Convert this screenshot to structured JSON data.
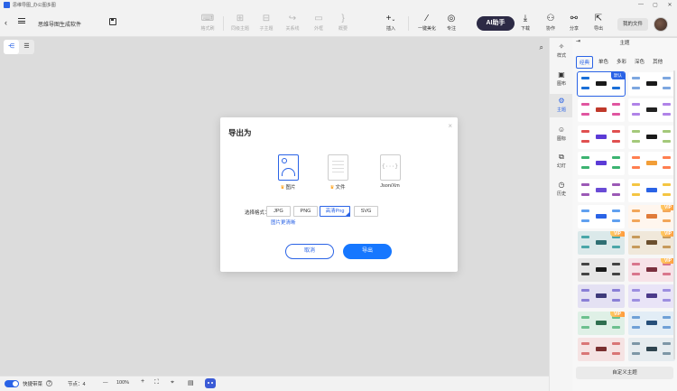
{
  "window": {
    "title": "思维导图_办公图多图",
    "controls": [
      "—",
      "▢",
      "✕"
    ]
  },
  "toolbar": {
    "doc_title": "思维导图生成软件",
    "tools": [
      {
        "id": "format-painter",
        "label": "格式刷",
        "icon": "paint-roller-icon"
      },
      {
        "id": "sibling-topic",
        "label": "同级主题",
        "icon": "sibling-topic-icon"
      },
      {
        "id": "child-topic",
        "label": "子主题",
        "icon": "child-topic-icon"
      },
      {
        "id": "relation",
        "label": "关系线",
        "icon": "relation-line-icon"
      },
      {
        "id": "outline",
        "label": "外框",
        "icon": "outline-box-icon"
      },
      {
        "id": "summary",
        "label": "概要",
        "icon": "summary-icon"
      },
      {
        "id": "insert",
        "label": "插入",
        "icon": "plus-icon"
      },
      {
        "id": "beautify",
        "label": "一键美化",
        "icon": "magic-wand-icon"
      },
      {
        "id": "focus",
        "label": "专注",
        "icon": "focus-target-icon"
      }
    ],
    "ai_label": "AI助手",
    "right_tools": [
      {
        "id": "download",
        "label": "下载",
        "icon": "download-icon"
      },
      {
        "id": "collaborate",
        "label": "协作",
        "icon": "people-icon"
      },
      {
        "id": "share",
        "label": "分享",
        "icon": "share-icon"
      },
      {
        "id": "export",
        "label": "导出",
        "icon": "export-icon"
      }
    ],
    "my_files": "我的文件"
  },
  "rail": [
    {
      "label": "样式",
      "icon": "style-icon"
    },
    {
      "label": "图布",
      "icon": "canvas-icon"
    },
    {
      "label": "主题",
      "icon": "theme-icon"
    },
    {
      "label": "图标",
      "icon": "emoji-icon"
    },
    {
      "label": "幻灯",
      "icon": "slides-icon"
    },
    {
      "label": "历史",
      "icon": "history-icon"
    }
  ],
  "panel": {
    "title": "主题",
    "tabs": [
      "经典",
      "单色",
      "多彩",
      "深色",
      "其他"
    ],
    "default_badge": "默认",
    "vip_badge": "VIP",
    "custom_theme": "自定义主题",
    "themes": [
      {
        "bg": "#ffffff",
        "center": "#1a1a1a",
        "nodes": "#1a6fd8",
        "vip": false,
        "selected": true
      },
      {
        "bg": "#ffffff",
        "center": "#1a1a1a",
        "nodes": "#7da7e0",
        "vip": false
      },
      {
        "bg": "#ffffff",
        "center": "#c0392b",
        "nodes": "#e056a0",
        "vip": false
      },
      {
        "bg": "#ffffff",
        "center": "#222222",
        "nodes": "#b083e8",
        "vip": false
      },
      {
        "bg": "#ffffff",
        "center": "#5b3bd6",
        "nodes": "#e05050",
        "vip": false
      },
      {
        "bg": "#ffffff",
        "center": "#1a1a1a",
        "nodes": "#a4c97a",
        "vip": false
      },
      {
        "bg": "#ffffff",
        "center": "#5b3bd6",
        "nodes": "#3cb371",
        "vip": false
      },
      {
        "bg": "#ffffff",
        "center": "#f29e38",
        "nodes": "#ff7f50",
        "vip": false
      },
      {
        "bg": "#ffffff",
        "center": "#6a4bd6",
        "nodes": "#9b59b6",
        "vip": false
      },
      {
        "bg": "#ffffff",
        "center": "#2a63e6",
        "nodes": "#f4c542",
        "vip": false
      },
      {
        "bg": "#ffffff",
        "center": "#2a63e6",
        "nodes": "#60a0f0",
        "vip": false
      },
      {
        "bg": "#fff6ee",
        "center": "#e07b39",
        "nodes": "#f2a65a",
        "vip": true
      },
      {
        "bg": "#dbe9ea",
        "center": "#2f6f73",
        "nodes": "#4aa6a8",
        "vip": true
      },
      {
        "bg": "#f0e8da",
        "center": "#6b4f2e",
        "nodes": "#c79a5b",
        "vip": true
      },
      {
        "bg": "#e6e6e6",
        "center": "#1a1a1a",
        "nodes": "#444444",
        "vip": false
      },
      {
        "bg": "#f7e3e8",
        "center": "#7a2f3e",
        "nodes": "#d9768c",
        "vip": true
      },
      {
        "bg": "#e4e1f3",
        "center": "#3e3a7a",
        "nodes": "#8a7fd6",
        "vip": false
      },
      {
        "bg": "#e9e4f7",
        "center": "#4b3a8a",
        "nodes": "#9d8ee0",
        "vip": false
      },
      {
        "bg": "#dff0e6",
        "center": "#2f6f4f",
        "nodes": "#6cc08e",
        "vip": true
      },
      {
        "bg": "#e2edf6",
        "center": "#274f7a",
        "nodes": "#6fa0d6",
        "vip": false
      },
      {
        "bg": "#f5e3e3",
        "center": "#7a2f2f",
        "nodes": "#d97676",
        "vip": false
      },
      {
        "bg": "#e6ecef",
        "center": "#2f4550",
        "nodes": "#7d97a6",
        "vip": false
      }
    ]
  },
  "status": {
    "quick_style": "快捷带菜",
    "help": "?",
    "nodes_label": "节点：4",
    "zoom": "100%",
    "minus": "—",
    "plus": "+"
  },
  "dialog": {
    "title": "导出为",
    "close": "×",
    "types": [
      {
        "id": "image",
        "label": "图片",
        "selected": true,
        "icon": "image-file-icon"
      },
      {
        "id": "doc",
        "label": "文件",
        "selected": false,
        "icon": "document-file-icon"
      },
      {
        "id": "json",
        "label": "Json/Xm",
        "selected": false,
        "icon": "code-file-icon",
        "glyph": "{···}"
      }
    ],
    "format_label": "选择格式：",
    "formats": [
      "JPG",
      "PNG",
      "高清Png",
      "SVG"
    ],
    "selected_format": "高清Png",
    "hd_link": "图片更清晰",
    "cancel": "取消",
    "export": "导出",
    "accent": "#1677ff"
  }
}
